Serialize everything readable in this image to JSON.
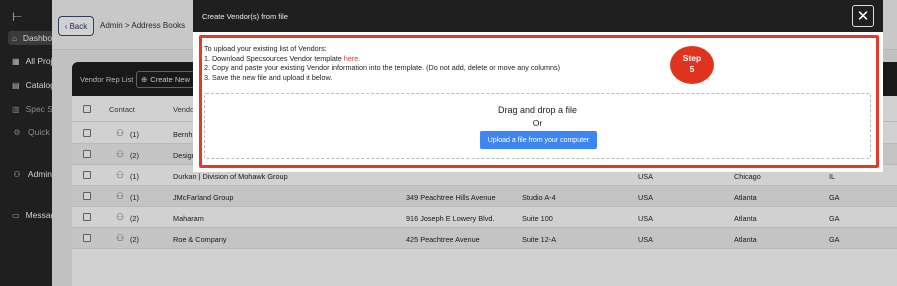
{
  "sidebar": {
    "logo": "⊢",
    "items": [
      {
        "label": "Dashboard",
        "icon": "home-icon",
        "glyph": "⌂",
        "active": true
      },
      {
        "label": "All Projects",
        "icon": "grid-icon",
        "glyph": "▦",
        "active": false
      },
      {
        "label": "Catalog",
        "icon": "catalog-icon",
        "glyph": "▤",
        "active": false
      },
      {
        "label": "Spec Sheets",
        "icon": "spec-icon",
        "glyph": "▥",
        "active": false
      },
      {
        "label": "Quick",
        "icon": "quick-icon",
        "glyph": "⚙",
        "active": false
      },
      {
        "label": "Admin",
        "icon": "user-icon",
        "glyph": "⚇",
        "active": false
      },
      {
        "label": "Messages",
        "icon": "message-icon",
        "glyph": "▭",
        "active": false
      }
    ]
  },
  "topbar": {
    "back_label": "Back",
    "breadcrumb": "Admin > Address Books"
  },
  "card": {
    "vendor_rep_list": "Vendor Rep List",
    "create_new": "Create New",
    "columns": {
      "contact": "Contact",
      "vendor": "Vendor"
    }
  },
  "rows": [
    {
      "contacts": "(1)",
      "name": "Bernhardt",
      "address": "",
      "suite": "",
      "country": "",
      "city": "",
      "state": ""
    },
    {
      "contacts": "(2)",
      "name": "Design",
      "address": "",
      "suite": "",
      "country": "",
      "city": "",
      "state": ""
    },
    {
      "contacts": "(1)",
      "name": "Durkan | Division of Mohawk Group",
      "address": "",
      "suite": "",
      "country": "USA",
      "city": "Chicago",
      "state": "IL"
    },
    {
      "contacts": "(1)",
      "name": "JMcFarland Group",
      "address": "349 Peachtree Hills Avenue",
      "suite": "Studio A-4",
      "country": "USA",
      "city": "Atlanta",
      "state": "GA"
    },
    {
      "contacts": "(2)",
      "name": "Maharam",
      "address": "916 Joseph E Lowery Blvd.",
      "suite": "Suite 100",
      "country": "USA",
      "city": "Atlanta",
      "state": "GA"
    },
    {
      "contacts": "(2)",
      "name": "Roe & Company",
      "address": "425 Peachtree Avenue",
      "suite": "Suite 12-A",
      "country": "USA",
      "city": "Atlanta",
      "state": "GA"
    }
  ],
  "modal": {
    "title": "Create Vendor(s) from file",
    "close_glyph": "✕",
    "instructions": {
      "intro": "To upload your existing list of Vendors:",
      "step1_prefix": "1. Download Specsources Vendor template ",
      "step1_link": "here.",
      "step2": "2. Copy and paste your existing Vendor information into the template. (Do not add, delete or move any columns)",
      "step3": "3. Save the new file and upload it below."
    },
    "step_badge": {
      "line1": "Step",
      "line2": "5"
    },
    "dropzone": {
      "title": "Drag and drop a file",
      "or": "Or",
      "button": "Upload a file from your computer"
    }
  },
  "colors": {
    "highlight": "#e23a28",
    "upload_button": "#3d86f2",
    "link": "#e2382a"
  }
}
